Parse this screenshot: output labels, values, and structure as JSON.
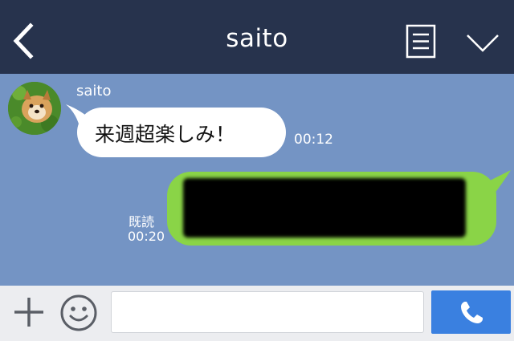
{
  "header": {
    "title": "saito",
    "back_icon": "chevron-left-icon",
    "menu_icon": "notes-menu-icon",
    "expand_icon": "chevron-down-icon"
  },
  "messages": [
    {
      "direction": "incoming",
      "sender": "saito",
      "text": "来週超楽しみ！",
      "time": "00:12"
    },
    {
      "direction": "outgoing",
      "text": "",
      "redacted": true,
      "read_status": "既読",
      "time": "00:20"
    }
  ],
  "input_bar": {
    "placeholder": "",
    "value": "",
    "plus_icon": "plus-icon",
    "emoji_icon": "emoji-icon",
    "call_icon": "phone-icon"
  },
  "colors": {
    "header_bg": "#27334d",
    "chat_bg": "#7494c4",
    "incoming_bubble": "#ffffff",
    "outgoing_bubble": "#8ad447",
    "call_button": "#3a80e0",
    "input_bar_bg": "#ecedf0"
  }
}
